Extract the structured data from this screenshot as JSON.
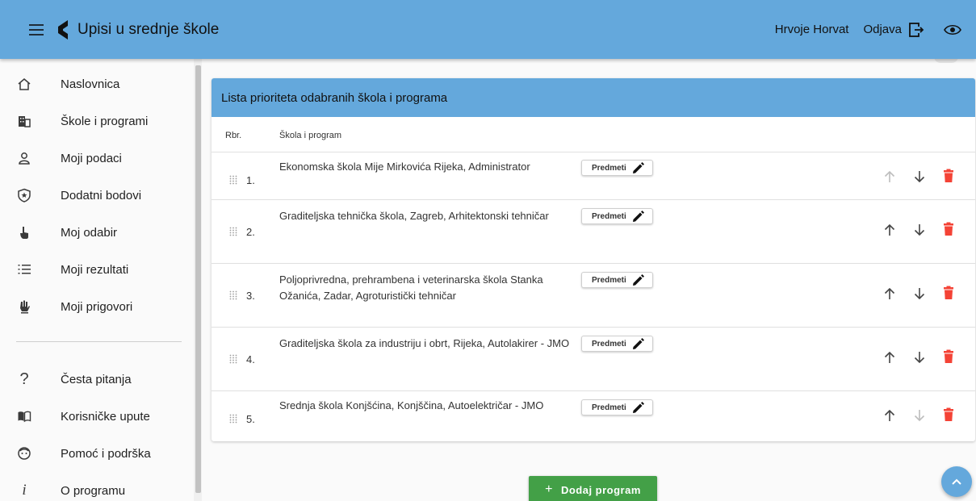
{
  "app": {
    "title": "Upisi u srednje škole",
    "user_name": "Hrvoje Horvat",
    "logout_label": "Odjava"
  },
  "sidebar": {
    "items": [
      {
        "label": "Naslovnica",
        "icon": "home-icon"
      },
      {
        "label": "Škole i programi",
        "icon": "building-icon"
      },
      {
        "label": "Moji podaci",
        "icon": "person-icon"
      },
      {
        "label": "Dodatni bodovi",
        "icon": "shield-star-icon"
      },
      {
        "label": "Moj odabir",
        "icon": "pointer-hand-icon"
      },
      {
        "label": "Moji rezultati",
        "icon": "list-icon"
      },
      {
        "label": "Moji prigovori",
        "icon": "raised-hand-icon"
      }
    ],
    "secondary_items": [
      {
        "label": "Česta pitanja",
        "icon": "question-icon"
      },
      {
        "label": "Korisničke upute",
        "icon": "book-icon"
      },
      {
        "label": "Pomoć i podrška",
        "icon": "support-icon"
      },
      {
        "label": "O programu",
        "icon": "info-icon"
      }
    ]
  },
  "card": {
    "title": "Lista prioriteta odabranih škola i programa",
    "col_rbr": "Rbr.",
    "col_school": "Škola i program",
    "subjects_label": "Predmeti",
    "rows": [
      {
        "num": "1.",
        "text": "Ekonomska škola Mije Mirkovića Rijeka, Administrator",
        "up_enabled": false,
        "down_enabled": true
      },
      {
        "num": "2.",
        "text": "Graditeljska tehnička škola, Zagreb, Arhitektonski tehničar",
        "up_enabled": true,
        "down_enabled": true
      },
      {
        "num": "3.",
        "text": "Poljoprivredna, prehrambena i veterinarska škola Stanka Ožanića, Zadar, Agroturistički tehničar",
        "up_enabled": true,
        "down_enabled": true
      },
      {
        "num": "4.",
        "text": "Graditeljska škola za industriju i obrt, Rijeka, Autolakirer - JMO",
        "up_enabled": true,
        "down_enabled": true
      },
      {
        "num": "5.",
        "text": "Srednja škola Konjšćina, Konjščina, Autoelektričar - JMO",
        "up_enabled": true,
        "down_enabled": false
      }
    ]
  },
  "add_button_label": "Dodaj program",
  "colors": {
    "primary": "#64a8dc",
    "add_green": "#43a047",
    "delete_red": "#f44336"
  }
}
